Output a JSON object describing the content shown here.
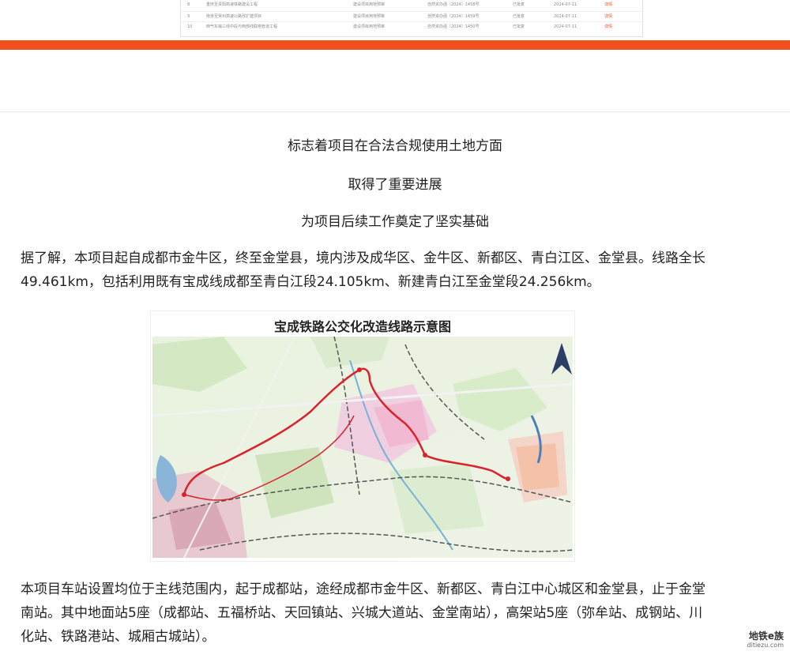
{
  "top_table": {
    "rows": [
      {
        "no": "8",
        "name": "重庆至贵阳高速铁路建设工程",
        "type": "建设项目用地预审",
        "doc": "自然资办函〔2024〕1458号",
        "status": "已批复",
        "date": "2024-07-11",
        "action": "详情"
      },
      {
        "no": "9",
        "name": "南京至常州高速公路改扩建项目",
        "type": "建设项目用地预审",
        "doc": "自然资办函〔2024〕1459号",
        "status": "已批复",
        "date": "2024-07-11",
        "action": "详情"
      },
      {
        "no": "10",
        "name": "西气东输三线中段与西部线联络管道工程",
        "type": "建设项目用地预审",
        "doc": "自然资办函〔2024〕1450号",
        "status": "已批复",
        "date": "2024-07-11",
        "action": "详情"
      }
    ]
  },
  "article": {
    "line1": "标志着项目在合法合规使用土地方面",
    "line2": "取得了重要进展",
    "line3": "为项目后续工作奠定了坚实基础",
    "paragraph1": "据了解，本项目起自成都市金牛区，终至金堂县，境内涉及成华区、金牛区、新都区、青白江区、金堂县。线路全长49.461km，包括利用既有宝成线成都至青白江段24.105km、新建青白江至金堂段24.256km。",
    "map_title": "宝成铁路公交化改造线路示意图",
    "paragraph2": "本项目车站设置均位于主线范围内，起于成都站，途经成都市金牛区、新都区、青白江中心城区和金堂县，止于金堂南站。其中地面站5座（成都站、五福桥站、天回镇站、兴城大道站、金堂南站），高架站5座（弥牟站、成钢站、川化站、铁路港站、城厢古城站）。"
  },
  "watermark": {
    "main": "地铁e族",
    "sub": "ditiezu.com"
  },
  "colors": {
    "accent": "#f0501e",
    "route": "#d8232a"
  }
}
